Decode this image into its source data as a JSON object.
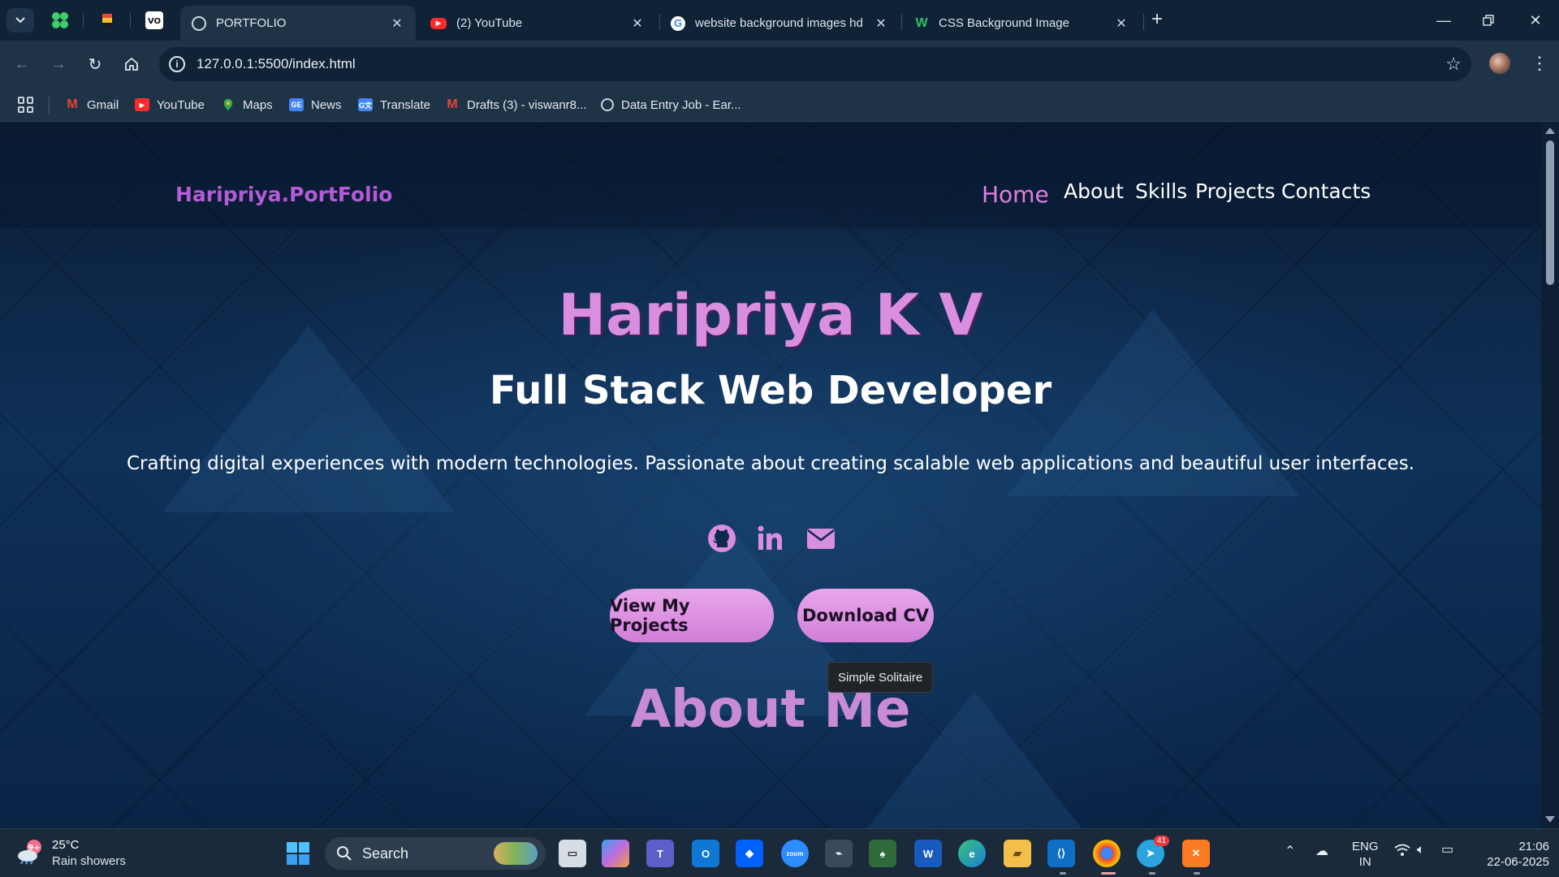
{
  "browser": {
    "pinned": [
      "app-grid-icon",
      "flag-icon",
      "vue-icon"
    ],
    "tabs": [
      {
        "title": "PORTFOLIO",
        "active": true,
        "favicon": "globe-icon"
      },
      {
        "title": "(2) YouTube",
        "active": false,
        "favicon": "youtube-icon"
      },
      {
        "title": "website background images hd",
        "active": false,
        "favicon": "google-icon"
      },
      {
        "title": "CSS Background Image",
        "active": false,
        "favicon": "w3schools-icon"
      }
    ],
    "url": "127.0.0.1:5500/index.html",
    "bookmarks": [
      {
        "label": "Gmail",
        "icon": "gmail-icon"
      },
      {
        "label": "YouTube",
        "icon": "youtube-icon"
      },
      {
        "label": "Maps",
        "icon": "maps-icon"
      },
      {
        "label": "News",
        "icon": "news-icon"
      },
      {
        "label": "Translate",
        "icon": "translate-icon"
      },
      {
        "label": "Drafts (3) - viswanr8...",
        "icon": "gmail-icon"
      },
      {
        "label": "Data Entry Job - Ear...",
        "icon": "globe-icon"
      }
    ]
  },
  "site": {
    "logo": "Haripriya.PortFolio",
    "nav": [
      "Home",
      "About",
      "Skills",
      "Projects",
      "Contacts"
    ],
    "current_nav": "Home",
    "hero": {
      "name": "Haripriya K V",
      "role": "Full Stack Web Developer",
      "description": "Crafting digital experiences with modern technologies. Passionate about creating scalable web applications and beautiful user interfaces."
    },
    "social_icons": [
      "github-icon",
      "linkedin-icon",
      "email-icon"
    ],
    "buttons": {
      "projects": "View My Projects",
      "cv": "Download CV"
    },
    "about_title": "About Me"
  },
  "tooltip": "Simple Solitaire",
  "taskbar": {
    "weather": {
      "temp": "25°C",
      "desc": "Rain showers",
      "badge": "9+"
    },
    "search_label": "Search",
    "apps": [
      "task-view-icon",
      "copilot-icon",
      "teams-icon",
      "outlook-icon",
      "dropbox-icon",
      "zoom-icon",
      "cast-icon",
      "solitaire-icon",
      "word-icon",
      "edge-icon",
      "file-explorer-icon",
      "vscode-icon",
      "chrome-icon",
      "telegram-icon",
      "xampp-icon"
    ],
    "telegram_badge": "41",
    "tray": {
      "lang_top": "ENG",
      "lang_bottom": "IN",
      "time": "21:06",
      "date": "22-06-2025"
    }
  },
  "colors": {
    "accent": "#d98ee0",
    "logo": "#b45bd6",
    "background": "#0e3057"
  }
}
